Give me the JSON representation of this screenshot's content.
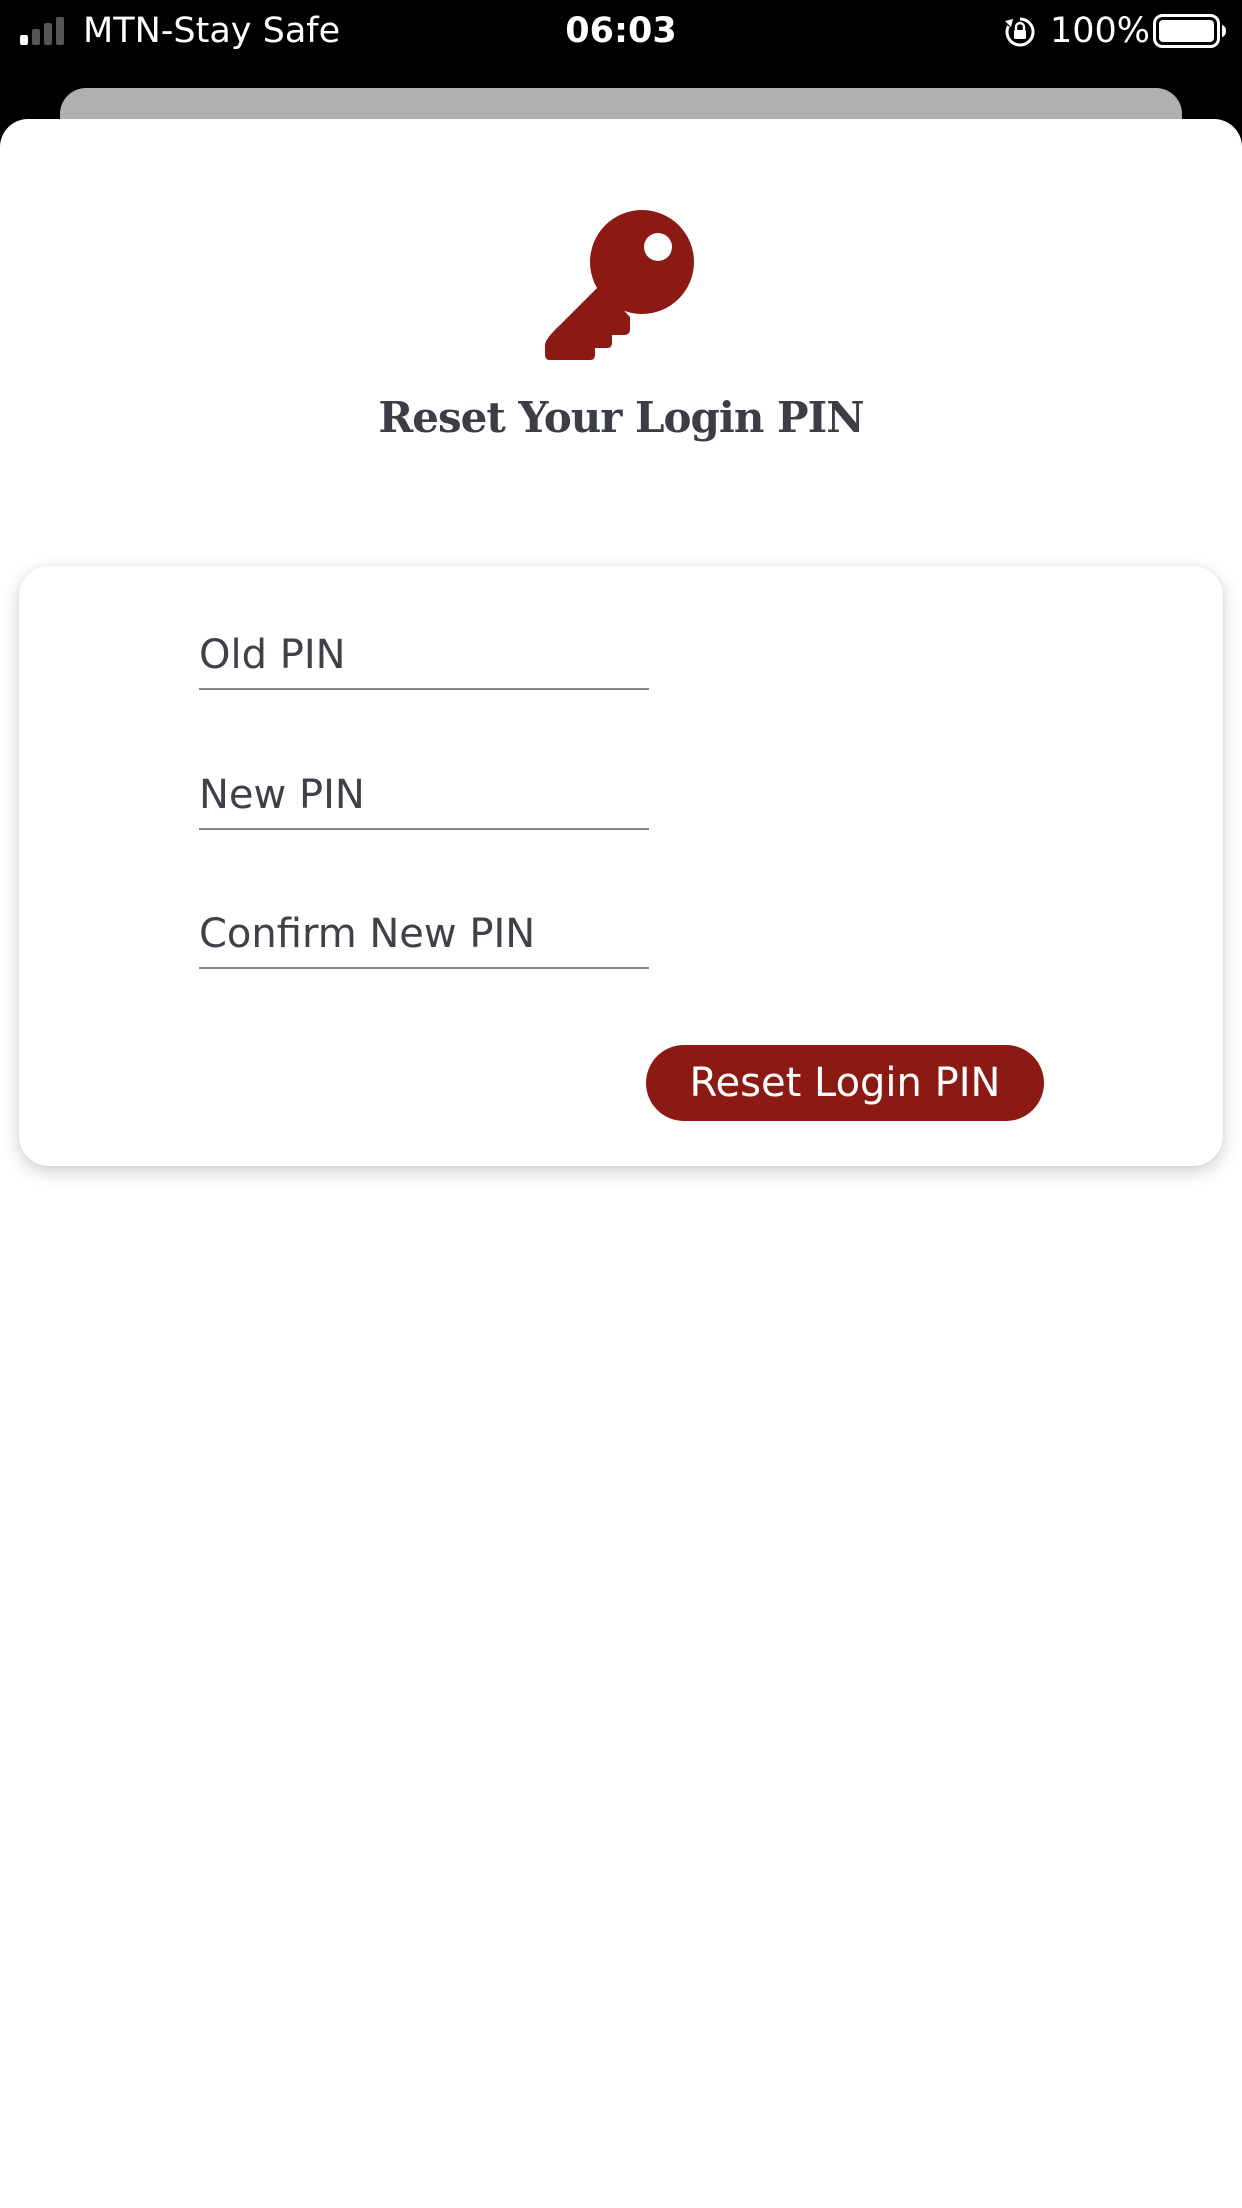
{
  "status_bar": {
    "carrier": "MTN-Stay Safe",
    "time": "06:03",
    "battery_percent": "100%",
    "signal_bars_active": 1,
    "signal_bars_total": 4,
    "icons": [
      "signal-icon",
      "orientation-lock-icon",
      "battery-icon"
    ]
  },
  "header": {
    "icon": "key-icon",
    "title": "Reset Your Login PIN"
  },
  "form": {
    "old_pin": {
      "placeholder": "Old PIN",
      "value": ""
    },
    "new_pin": {
      "placeholder": "New PIN",
      "value": ""
    },
    "confirm_pin": {
      "placeholder": "Confirm New PIN",
      "value": ""
    },
    "submit_label": "Reset Login PIN"
  },
  "colors": {
    "accent": "#8b1a14",
    "title_text": "#3b3e44",
    "background": "#ffffff",
    "status_bar": "#000000"
  }
}
